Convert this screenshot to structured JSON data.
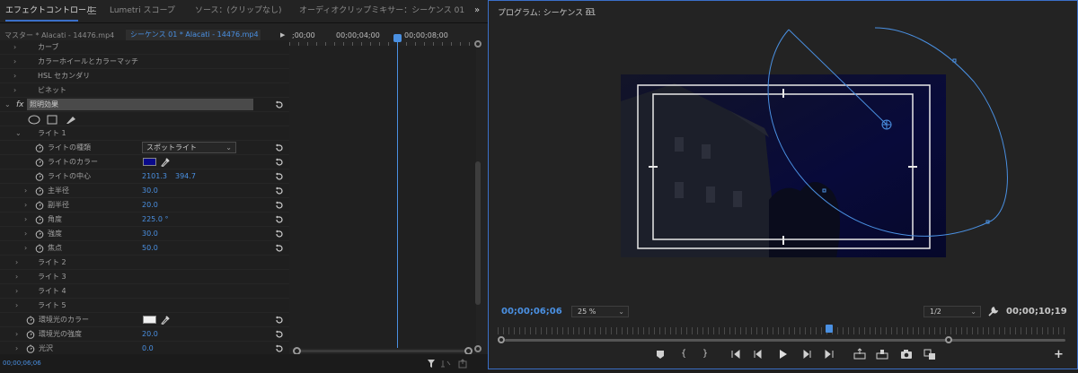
{
  "left_tabs": [
    {
      "label": "エフェクトコントロール",
      "active": true
    },
    {
      "label": "Lumetri スコープ",
      "active": false
    },
    {
      "label": "ソース：(クリップなし)",
      "active": false
    },
    {
      "label": "オーディオクリップミキサー：シーケンス 01",
      "active": false
    }
  ],
  "header": {
    "master": "マスター * Alacati - 14476.mp4",
    "sequence": "シーケンス 01 * Alacati - 14476.mp4",
    "expand_glyph": "»"
  },
  "timeline": {
    "tc_start": ";00;00",
    "tc_mid": "00;00;04;00",
    "tc_end": "00;00;08;00"
  },
  "effects": {
    "curves": "カーブ",
    "color_wheels": "カラーホイールとカラーマッチ",
    "hsl_secondary": "HSL セカンダリ",
    "vignette": "ビネット",
    "fx_name": "照明効果",
    "light1": "ライト 1",
    "light_type_label": "ライトの種類",
    "light_type_value": "スポットライト",
    "light_color_label": "ライトのカラー",
    "light_color": "#0a0a8a",
    "light_center_label": "ライトの中心",
    "light_center_x": "2101.3",
    "light_center_y": "394.7",
    "major_radius_label": "主半径",
    "major_radius": "30.0",
    "minor_radius_label": "副半径",
    "minor_radius": "20.0",
    "angle_label": "角度",
    "angle": "225.0 °",
    "intensity_label": "強度",
    "intensity": "30.0",
    "focus_label": "焦点",
    "focus": "50.0",
    "light2": "ライト 2",
    "light3": "ライト 3",
    "light4": "ライト 4",
    "light5": "ライト 5",
    "ambient_color_label": "環境光のカラー",
    "ambient_color": "#f0f0f0",
    "ambient_intensity_label": "環境光の強度",
    "ambient_intensity": "20.0",
    "gloss_label": "光沢",
    "gloss": "0.0"
  },
  "status": {
    "timecode": "00;00;06;06"
  },
  "program": {
    "title": "プログラム: シーケンス 01",
    "timecode": "00;00;06;06",
    "zoom": "25 %",
    "resolution": "1/2",
    "duration": "00;00;10;19",
    "playhead_fraction": 0.58
  },
  "colors": {
    "accent": "#4a90e2",
    "panel_border": "#3a6fc8"
  }
}
